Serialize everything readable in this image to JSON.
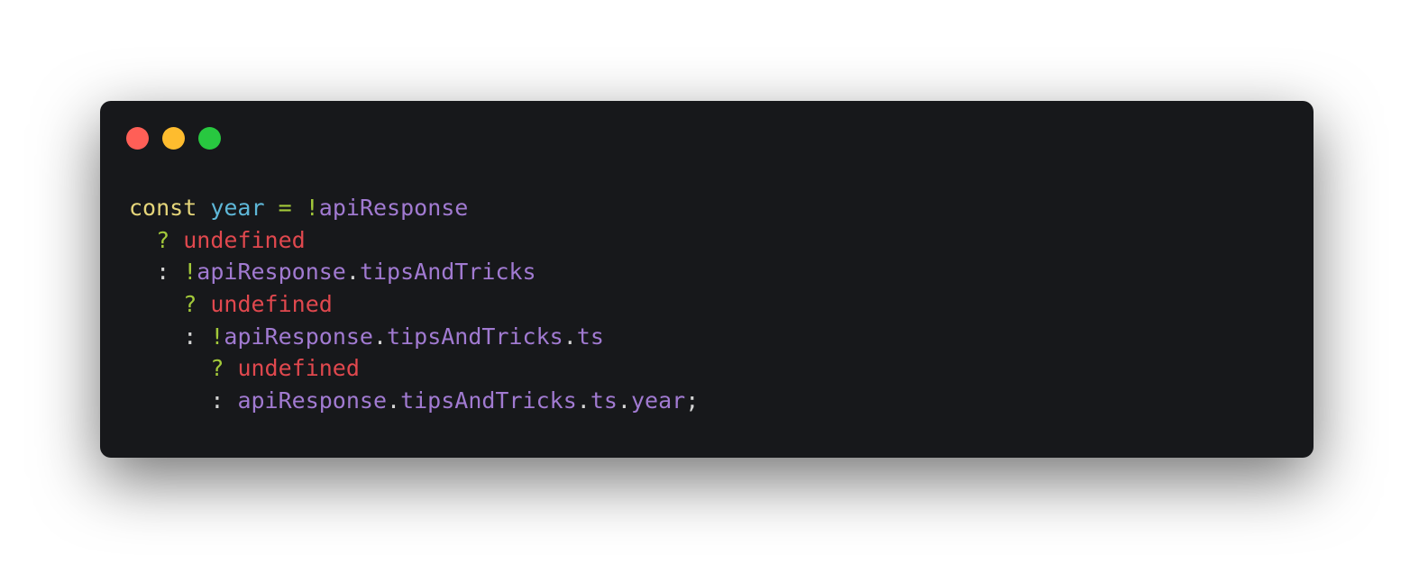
{
  "window": {
    "controls": [
      {
        "name": "close-button",
        "color": "#ff5f57"
      },
      {
        "name": "minimize-button",
        "color": "#febc2e"
      },
      {
        "name": "maximize-button",
        "color": "#28c840"
      }
    ]
  },
  "palette": {
    "keyword": "#e5d57a",
    "variable": "#5eb7d8",
    "operator": "#a3c93a",
    "identifier": "#a17ad1",
    "punct": "#d4d4d4",
    "undefined": "#e0484e"
  },
  "code": {
    "lines": [
      [
        {
          "t": "const",
          "k": "keyword"
        },
        {
          "t": " ",
          "k": "punct"
        },
        {
          "t": "year",
          "k": "variable"
        },
        {
          "t": " ",
          "k": "punct"
        },
        {
          "t": "=",
          "k": "operator"
        },
        {
          "t": " ",
          "k": "punct"
        },
        {
          "t": "!",
          "k": "operator"
        },
        {
          "t": "apiResponse",
          "k": "identifier"
        }
      ],
      [
        {
          "t": "  ",
          "k": "punct"
        },
        {
          "t": "?",
          "k": "operator"
        },
        {
          "t": " ",
          "k": "punct"
        },
        {
          "t": "undefined",
          "k": "undefined"
        }
      ],
      [
        {
          "t": "  ",
          "k": "punct"
        },
        {
          "t": ":",
          "k": "punct"
        },
        {
          "t": " ",
          "k": "punct"
        },
        {
          "t": "!",
          "k": "operator"
        },
        {
          "t": "apiResponse",
          "k": "identifier"
        },
        {
          "t": ".",
          "k": "punct"
        },
        {
          "t": "tipsAndTricks",
          "k": "identifier"
        }
      ],
      [
        {
          "t": "    ",
          "k": "punct"
        },
        {
          "t": "?",
          "k": "operator"
        },
        {
          "t": " ",
          "k": "punct"
        },
        {
          "t": "undefined",
          "k": "undefined"
        }
      ],
      [
        {
          "t": "    ",
          "k": "punct"
        },
        {
          "t": ":",
          "k": "punct"
        },
        {
          "t": " ",
          "k": "punct"
        },
        {
          "t": "!",
          "k": "operator"
        },
        {
          "t": "apiResponse",
          "k": "identifier"
        },
        {
          "t": ".",
          "k": "punct"
        },
        {
          "t": "tipsAndTricks",
          "k": "identifier"
        },
        {
          "t": ".",
          "k": "punct"
        },
        {
          "t": "ts",
          "k": "identifier"
        }
      ],
      [
        {
          "t": "      ",
          "k": "punct"
        },
        {
          "t": "?",
          "k": "operator"
        },
        {
          "t": " ",
          "k": "punct"
        },
        {
          "t": "undefined",
          "k": "undefined"
        }
      ],
      [
        {
          "t": "      ",
          "k": "punct"
        },
        {
          "t": ":",
          "k": "punct"
        },
        {
          "t": " ",
          "k": "punct"
        },
        {
          "t": "apiResponse",
          "k": "identifier"
        },
        {
          "t": ".",
          "k": "punct"
        },
        {
          "t": "tipsAndTricks",
          "k": "identifier"
        },
        {
          "t": ".",
          "k": "punct"
        },
        {
          "t": "ts",
          "k": "identifier"
        },
        {
          "t": ".",
          "k": "punct"
        },
        {
          "t": "year",
          "k": "identifier"
        },
        {
          "t": ";",
          "k": "punct"
        }
      ]
    ]
  }
}
